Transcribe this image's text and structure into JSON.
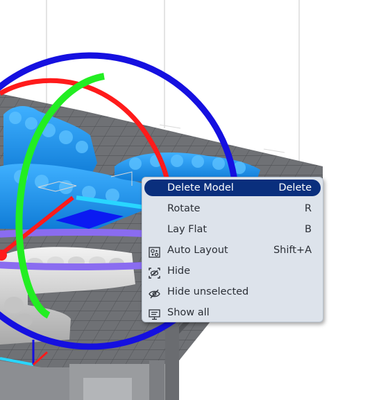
{
  "viewport": {
    "description_icons": [
      "rotate-gizmo-icon"
    ]
  },
  "context_menu": {
    "items": [
      {
        "label": "Delete Model",
        "shortcut": "Delete",
        "icon": "",
        "highlighted": true
      },
      {
        "label": "Rotate",
        "shortcut": "R",
        "icon": ""
      },
      {
        "label": "Lay Flat",
        "shortcut": "B",
        "icon": ""
      },
      {
        "label": "Auto Layout",
        "shortcut": "Shift+A",
        "icon": "auto-layout-icon"
      },
      {
        "label": "Hide",
        "shortcut": "",
        "icon": "hide-icon"
      },
      {
        "label": "Hide unselected",
        "shortcut": "",
        "icon": "eye-icon"
      },
      {
        "label": "Show all",
        "shortcut": "",
        "icon": "monitor-icon"
      }
    ]
  },
  "colors": {
    "highlight": "#0a2f7d",
    "menu_bg": "#dde3eb",
    "model_blue": "#1a8fe8",
    "gizmo_x": "#ff2020",
    "gizmo_y": "#22ee22",
    "gizmo_z": "#1010ee"
  }
}
